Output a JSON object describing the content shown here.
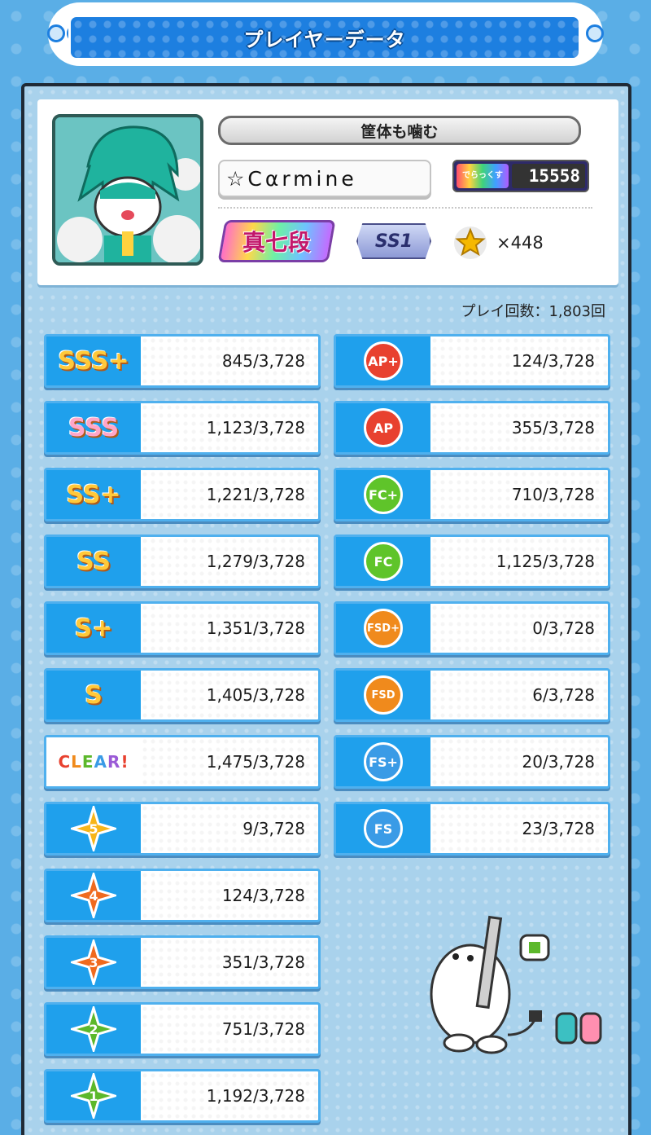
{
  "header": {
    "title": "プレイヤーデータ"
  },
  "profile": {
    "title_plate": "筐体も噛む",
    "player_name": "☆Cαrmine",
    "rating_label": "でらっくす RATING",
    "rating_value": "15558",
    "dan": "真七段",
    "class": "SS1",
    "star_count": "×448"
  },
  "play_count": "プレイ回数：1,803回",
  "rank_stats": [
    {
      "icon": "sss-plus-rank-icon",
      "label": "SSS+",
      "value": "845/3,728"
    },
    {
      "icon": "sss-rank-icon",
      "label": "SSS",
      "value": "1,123/3,728"
    },
    {
      "icon": "ss-plus-rank-icon",
      "label": "SS+",
      "value": "1,221/3,728"
    },
    {
      "icon": "ss-rank-icon",
      "label": "SS",
      "value": "1,279/3,728"
    },
    {
      "icon": "s-plus-rank-icon",
      "label": "S+",
      "value": "1,351/3,728"
    },
    {
      "icon": "s-rank-icon",
      "label": "S",
      "value": "1,405/3,728"
    },
    {
      "icon": "clear-icon",
      "label": "CLEAR!",
      "value": "1,475/3,728"
    },
    {
      "icon": "star-5-icon",
      "label": "5",
      "value": "9/3,728"
    },
    {
      "icon": "star-4-icon",
      "label": "4",
      "value": "124/3,728"
    },
    {
      "icon": "star-3-icon",
      "label": "3",
      "value": "351/3,728"
    },
    {
      "icon": "star-2-icon",
      "label": "2",
      "value": "751/3,728"
    },
    {
      "icon": "star-1-icon",
      "label": "1",
      "value": "1,192/3,728"
    }
  ],
  "combo_stats": [
    {
      "icon": "ap-plus-icon",
      "label": "AP+",
      "value": "124/3,728"
    },
    {
      "icon": "ap-icon",
      "label": "AP",
      "value": "355/3,728"
    },
    {
      "icon": "fc-plus-icon",
      "label": "FC+",
      "value": "710/3,728"
    },
    {
      "icon": "fc-icon",
      "label": "FC",
      "value": "1,125/3,728"
    },
    {
      "icon": "fsd-plus-icon",
      "label": "FSD+",
      "value": "0/3,728"
    },
    {
      "icon": "fsd-icon",
      "label": "FSD",
      "value": "6/3,728"
    },
    {
      "icon": "fs-plus-icon",
      "label": "FS+",
      "value": "20/3,728"
    },
    {
      "icon": "fs-icon",
      "label": "FS",
      "value": "23/3,728"
    }
  ],
  "colors": {
    "background": "#5aaee6",
    "header_blue": "#1d7fe0",
    "icon_box_blue": "#1fa0ec",
    "ap_red": "#e8412f",
    "fc_green": "#5fc42a",
    "fsd_orange": "#f08a1c",
    "fs_blue": "#3a9be6",
    "star5_yellow": "#f7b519",
    "star43_orange": "#f06a1e",
    "star21_green": "#5cb82b"
  }
}
